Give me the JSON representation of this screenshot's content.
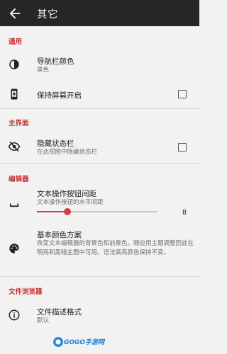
{
  "appbar": {
    "title": "其它"
  },
  "sections": {
    "general": "通用",
    "main_ui": "主界面",
    "editor": "编辑器",
    "file_browser": "文件浏览器"
  },
  "settings": {
    "nav_bar_color": {
      "title": "导航栏颜色",
      "subtitle": "黑色"
    },
    "keep_screen_on": {
      "title": "保持屏幕开启",
      "checked": false
    },
    "hide_status_bar": {
      "title": "隐藏状态栏",
      "subtitle": "在此视图中隐藏状态栏",
      "checked": false
    },
    "text_action_spacing": {
      "title": "文本操作按钮间距",
      "subtitle": "文本操作按钮的水平间距",
      "value": "8",
      "fraction": 0.25
    },
    "basic_color_scheme": {
      "title": "基本颜色方案",
      "subtitle": "改变文本编辑器的背景色和前景色。随应用主题调整因此在明亮和黑暗主题中可用。语法高亮颜色保持不变。"
    },
    "file_description_format": {
      "title": "文件描述格式",
      "subtitle": "默认"
    }
  },
  "watermark": {
    "text": "GOGO手游网"
  },
  "colors": {
    "accent": "#d64040",
    "section": "#c7322f",
    "appbar": "#262626"
  }
}
